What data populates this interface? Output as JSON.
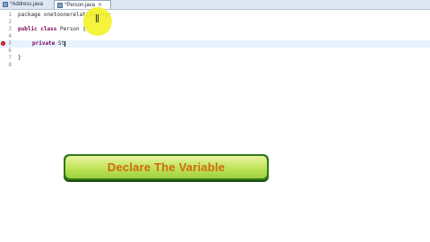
{
  "tabs": [
    {
      "label": "*Address.java",
      "active": false
    },
    {
      "label": "*Person.java",
      "active": true,
      "close": "✕"
    }
  ],
  "code": {
    "line1": {
      "no": "1",
      "text": "package onetoonerelationship;"
    },
    "line2": {
      "no": "2",
      "text": ""
    },
    "line3": {
      "no": "3",
      "kw1": "public",
      "kw2": "class",
      "rest": " Person {"
    },
    "line4": {
      "no": "4",
      "text": ""
    },
    "line5": {
      "no": "5",
      "kw": "private",
      "rest": " St"
    },
    "line6": {
      "no": "6",
      "text": ""
    },
    "line7": {
      "no": "7",
      "text": "}"
    },
    "line8": {
      "no": "8",
      "text": ""
    }
  },
  "banner": {
    "text": "Declare The Variable"
  },
  "colors": {
    "keyword": "#7f0055",
    "banner_text": "#d06a10",
    "banner_border": "#2f7a18",
    "highlight": "#f4f226"
  }
}
